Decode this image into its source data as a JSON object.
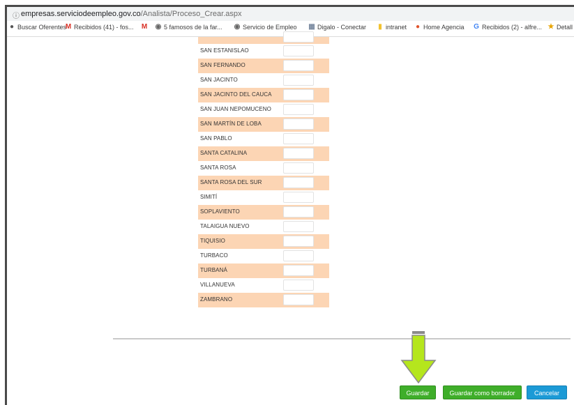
{
  "browser": {
    "url_host": "empresas.serviciodeempleo.gov.co",
    "url_path": "/Analista/Proceso_Crear.aspx"
  },
  "bookmarks": [
    {
      "label": "Buscar Oferentes",
      "icon": "circle-icon"
    },
    {
      "label": "Recibidos (41) - fos...",
      "icon": "gmail-icon"
    },
    {
      "label": "",
      "icon": "gmail-icon"
    },
    {
      "label": "5 famosos de la far...",
      "icon": "globe-icon"
    },
    {
      "label": "Servicio de Empleo",
      "icon": "globe-icon"
    },
    {
      "label": "Digalo - Conectar",
      "icon": "grid-icon"
    },
    {
      "label": "intranet",
      "icon": "page-icon"
    },
    {
      "label": "Home Agencia",
      "icon": "flame-icon"
    },
    {
      "label": "Recibidos (2) - alfre...",
      "icon": "google-icon"
    },
    {
      "label": "Detall",
      "icon": "star-icon"
    }
  ],
  "municipalities": [
    {
      "name": "SAN ESTANISLAO",
      "value": ""
    },
    {
      "name": "SAN FERNANDO",
      "value": ""
    },
    {
      "name": "SAN JACINTO",
      "value": ""
    },
    {
      "name": "SAN JACINTO DEL CAUCA",
      "value": ""
    },
    {
      "name": "SAN JUAN NEPOMUCENO",
      "value": ""
    },
    {
      "name": "SAN MARTÍN DE LOBA",
      "value": ""
    },
    {
      "name": "SAN PABLO",
      "value": ""
    },
    {
      "name": "SANTA CATALINA",
      "value": ""
    },
    {
      "name": "SANTA ROSA",
      "value": ""
    },
    {
      "name": "SANTA ROSA DEL SUR",
      "value": ""
    },
    {
      "name": "SIMITÍ",
      "value": ""
    },
    {
      "name": "SOPLAVIENTO",
      "value": ""
    },
    {
      "name": "TALAIGUA NUEVO",
      "value": ""
    },
    {
      "name": "TIQUISIO",
      "value": ""
    },
    {
      "name": "TURBACO",
      "value": ""
    },
    {
      "name": "TURBANÁ",
      "value": ""
    },
    {
      "name": "VILLANUEVA",
      "value": ""
    },
    {
      "name": "ZAMBRANO",
      "value": ""
    }
  ],
  "actions": {
    "save": "Guardar",
    "save_draft": "Guardar como borrador",
    "cancel": "Cancelar"
  },
  "colors": {
    "row_shade": "#fcd5b4",
    "green": "#3fae2a",
    "blue": "#1c9ad6",
    "arrow": "#b5e61d"
  }
}
